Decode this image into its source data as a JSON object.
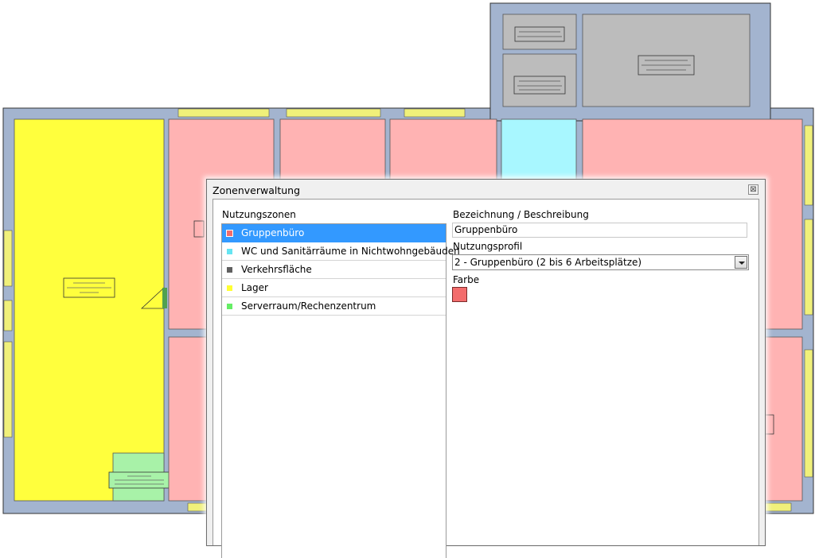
{
  "window": {
    "title": "Zonenverwaltung",
    "close_symbol": "⊠"
  },
  "zones": {
    "header": "Nutzungszonen",
    "items": [
      {
        "label": "Gruppenbüro",
        "color": "#f36c6c",
        "selected": true
      },
      {
        "label": "WC und Sanitärräume in Nichtwohngebäuden",
        "color": "#66e5f2",
        "selected": false
      },
      {
        "label": "Verkehrsfläche",
        "color": "#606060",
        "selected": false
      },
      {
        "label": "Lager",
        "color": "#ffff33",
        "selected": false
      },
      {
        "label": "Serverraum/Rechenzentrum",
        "color": "#66ee66",
        "selected": false
      }
    ]
  },
  "details": {
    "name_label": "Bezeichnung / Beschreibung",
    "name_value": "Gruppenbüro",
    "profile_label": "Nutzungsprofil",
    "profile_value": "2 - Gruppenbüro (2 bis 6 Arbeitsplätze)",
    "color_label": "Farbe",
    "color_value": "#f36c6c"
  },
  "plan": {
    "colors": {
      "wall": "#a3b4cf",
      "office": "#ffb3b3",
      "storage": "#ffff3d",
      "sanitary": "#a8f7ff",
      "server": "#a8f2a8",
      "grey_room": "#bcbcbc",
      "window": "#f0f07a"
    }
  }
}
